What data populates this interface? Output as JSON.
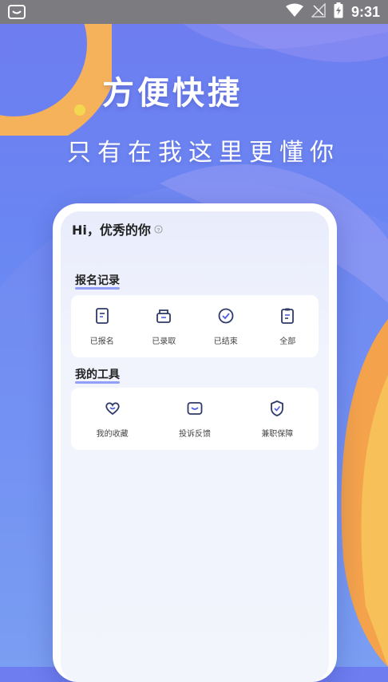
{
  "status_bar": {
    "time": "9:31",
    "left_icon": "app-notification-icon",
    "icons": [
      "wifi-icon",
      "no-signal-icon",
      "battery-charging-icon"
    ]
  },
  "hero": {
    "title": "方便快捷",
    "subtitle": "只有在我这里更懂你"
  },
  "phone": {
    "greeting": "Hi，优秀的你",
    "signup_section": {
      "title": "报名记录",
      "items": [
        {
          "label": "已报名",
          "icon": "signup-doc-icon"
        },
        {
          "label": "已录取",
          "icon": "admitted-box-icon"
        },
        {
          "label": "已结束",
          "icon": "check-circle-icon"
        },
        {
          "label": "全部",
          "icon": "clipboard-icon"
        }
      ]
    },
    "tools_section": {
      "title": "我的工具",
      "items": [
        {
          "label": "我的收藏",
          "icon": "heart-icon"
        },
        {
          "label": "投诉反馈",
          "icon": "feedback-icon"
        },
        {
          "label": "兼职保障",
          "icon": "shield-check-icon"
        }
      ]
    }
  },
  "colors": {
    "accent": "#4f5fe0",
    "background_top": "#6e7df0",
    "background_bottom": "#79a6f1",
    "decor_orange": "#f6b25a",
    "decor_yellow": "#f3d84f",
    "status_bar": "#7b7b80"
  }
}
